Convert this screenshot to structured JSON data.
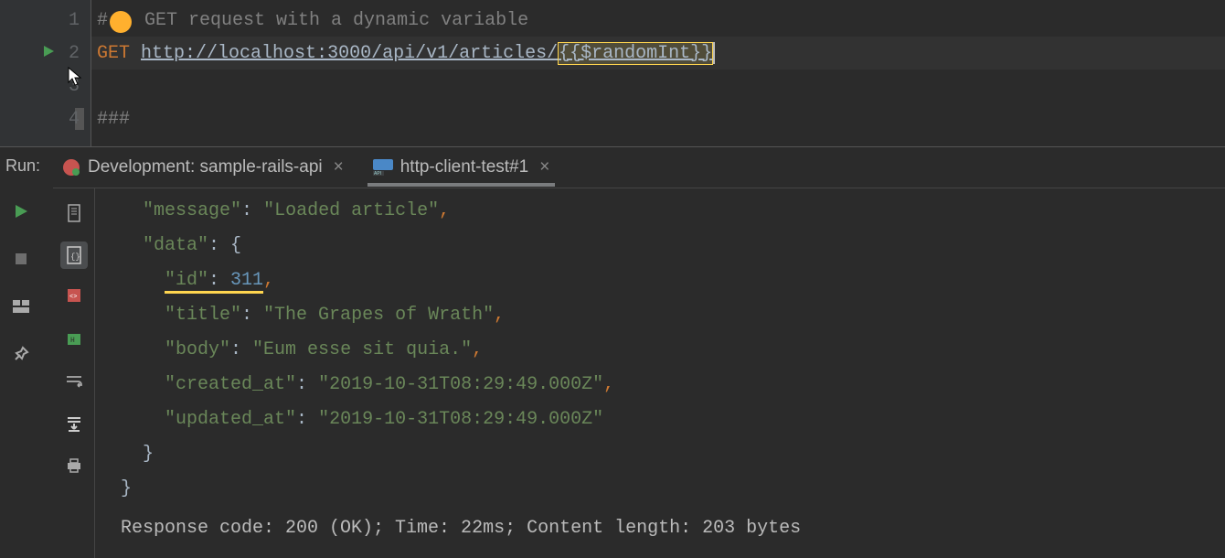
{
  "editor": {
    "lines": {
      "l1": "1",
      "l2": "2",
      "l3": "3",
      "l4": "4"
    },
    "comment_prefix": "#",
    "comment_suffix": " GET request with a dynamic variable",
    "method": "GET",
    "url_base": "http://localhost:3000/api/v1/articles/",
    "variable": "{{$randomInt}}",
    "separator": "###"
  },
  "run_panel": {
    "label": "Run:",
    "tabs": {
      "dev": "Development: sample-rails-api",
      "http": "http-client-test#1"
    }
  },
  "response": {
    "message_key": "\"message\"",
    "message_val": "\"Loaded article\"",
    "data_key": "\"data\"",
    "id_key": "\"id\"",
    "id_val": "311",
    "title_key": "\"title\"",
    "title_val": "\"The Grapes of Wrath\"",
    "body_key": "\"body\"",
    "body_val": "\"Eum esse sit quia.\"",
    "created_key": "\"created_at\"",
    "created_val": "\"2019-10-31T08:29:49.000Z\"",
    "updated_key": "\"updated_at\"",
    "updated_val": "\"2019-10-31T08:29:49.000Z\""
  },
  "status": "Response code: 200 (OK); Time: 22ms; Content length: 203 bytes"
}
